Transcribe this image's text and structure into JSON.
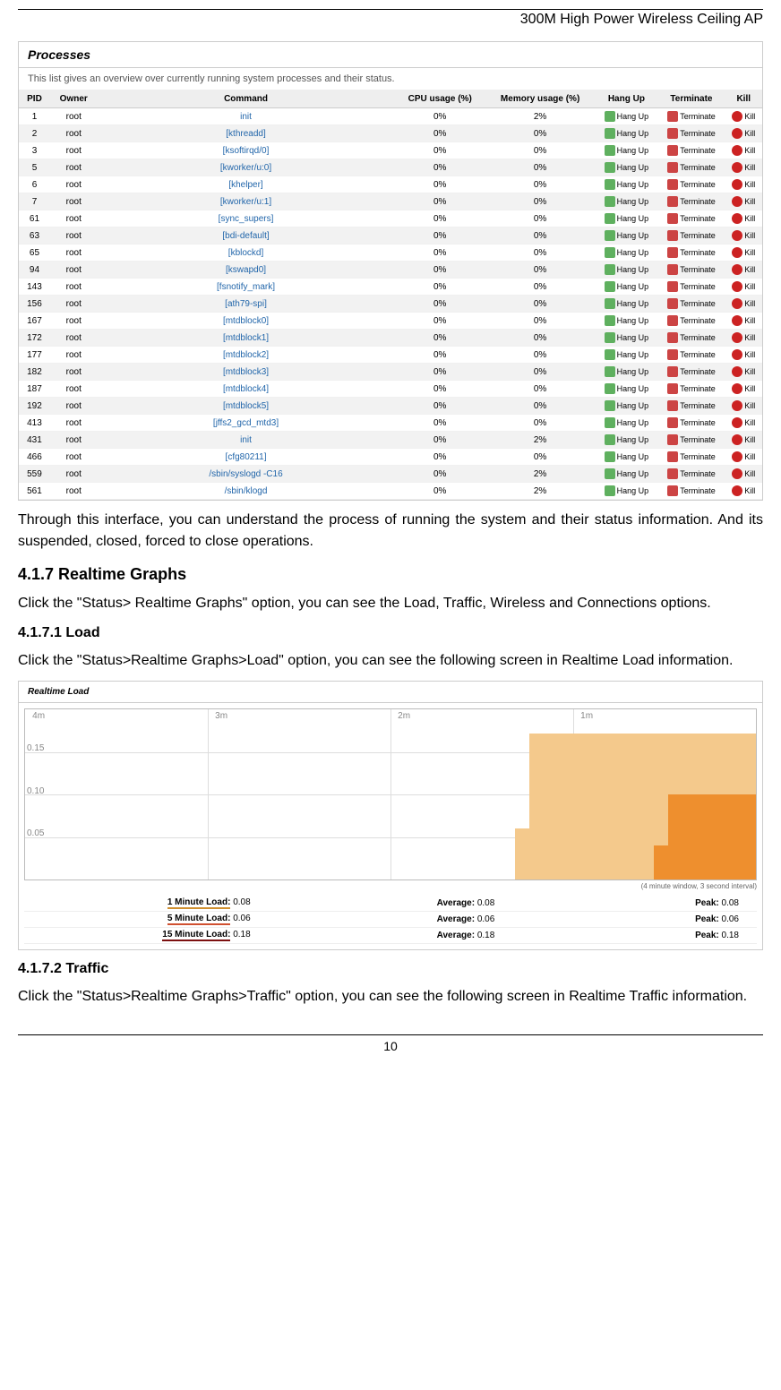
{
  "header": {
    "title": "300M High Power Wireless Ceiling AP"
  },
  "processes": {
    "title": "Processes",
    "subtitle": "This list gives an overview over currently running system processes and their status.",
    "columns": [
      "PID",
      "Owner",
      "Command",
      "CPU usage (%)",
      "Memory usage (%)",
      "Hang Up",
      "Terminate",
      "Kill"
    ],
    "hangup_label": "Hang Up",
    "terminate_label": "Terminate",
    "kill_label": "Kill",
    "rows": [
      {
        "pid": "1",
        "owner": "root",
        "cmd": "init",
        "cpu": "0%",
        "mem": "2%"
      },
      {
        "pid": "2",
        "owner": "root",
        "cmd": "[kthreadd]",
        "cpu": "0%",
        "mem": "0%"
      },
      {
        "pid": "3",
        "owner": "root",
        "cmd": "[ksoftirqd/0]",
        "cpu": "0%",
        "mem": "0%"
      },
      {
        "pid": "5",
        "owner": "root",
        "cmd": "[kworker/u:0]",
        "cpu": "0%",
        "mem": "0%"
      },
      {
        "pid": "6",
        "owner": "root",
        "cmd": "[khelper]",
        "cpu": "0%",
        "mem": "0%"
      },
      {
        "pid": "7",
        "owner": "root",
        "cmd": "[kworker/u:1]",
        "cpu": "0%",
        "mem": "0%"
      },
      {
        "pid": "61",
        "owner": "root",
        "cmd": "[sync_supers]",
        "cpu": "0%",
        "mem": "0%"
      },
      {
        "pid": "63",
        "owner": "root",
        "cmd": "[bdi-default]",
        "cpu": "0%",
        "mem": "0%"
      },
      {
        "pid": "65",
        "owner": "root",
        "cmd": "[kblockd]",
        "cpu": "0%",
        "mem": "0%"
      },
      {
        "pid": "94",
        "owner": "root",
        "cmd": "[kswapd0]",
        "cpu": "0%",
        "mem": "0%"
      },
      {
        "pid": "143",
        "owner": "root",
        "cmd": "[fsnotify_mark]",
        "cpu": "0%",
        "mem": "0%"
      },
      {
        "pid": "156",
        "owner": "root",
        "cmd": "[ath79-spi]",
        "cpu": "0%",
        "mem": "0%"
      },
      {
        "pid": "167",
        "owner": "root",
        "cmd": "[mtdblock0]",
        "cpu": "0%",
        "mem": "0%"
      },
      {
        "pid": "172",
        "owner": "root",
        "cmd": "[mtdblock1]",
        "cpu": "0%",
        "mem": "0%"
      },
      {
        "pid": "177",
        "owner": "root",
        "cmd": "[mtdblock2]",
        "cpu": "0%",
        "mem": "0%"
      },
      {
        "pid": "182",
        "owner": "root",
        "cmd": "[mtdblock3]",
        "cpu": "0%",
        "mem": "0%"
      },
      {
        "pid": "187",
        "owner": "root",
        "cmd": "[mtdblock4]",
        "cpu": "0%",
        "mem": "0%"
      },
      {
        "pid": "192",
        "owner": "root",
        "cmd": "[mtdblock5]",
        "cpu": "0%",
        "mem": "0%"
      },
      {
        "pid": "413",
        "owner": "root",
        "cmd": "[jffs2_gcd_mtd3]",
        "cpu": "0%",
        "mem": "0%"
      },
      {
        "pid": "431",
        "owner": "root",
        "cmd": "init",
        "cpu": "0%",
        "mem": "2%"
      },
      {
        "pid": "466",
        "owner": "root",
        "cmd": "[cfg80211]",
        "cpu": "0%",
        "mem": "0%"
      },
      {
        "pid": "559",
        "owner": "root",
        "cmd": "/sbin/syslogd -C16",
        "cpu": "0%",
        "mem": "2%"
      },
      {
        "pid": "561",
        "owner": "root",
        "cmd": "/sbin/klogd",
        "cpu": "0%",
        "mem": "2%"
      }
    ]
  },
  "para1": "Through this interface, you can understand the process of running the system and their status information. And its suspended, closed, forced to close operations.",
  "sec417": {
    "title": "4.1.7 Realtime Graphs",
    "text": "Click the \"Status> Realtime Graphs\" option, you can see the Load, Traffic, Wireless and Connections options."
  },
  "sec4171": {
    "title": "4.1.7.1 Load",
    "text": "Click the \"Status>Realtime Graphs>Load\" option, you can see the following screen in Realtime Load information."
  },
  "realtime": {
    "title": "Realtime Load",
    "xlabels": [
      "4m",
      "3m",
      "2m",
      "1m"
    ],
    "ylabels": [
      "0.15",
      "0.10",
      "0.05"
    ],
    "caption": "(4 minute window, 3 second interval)",
    "stats": {
      "r1": {
        "k": "1 Minute Load:",
        "v": "0.08",
        "avg_k": "Average:",
        "avg_v": "0.08",
        "peak_k": "Peak:",
        "peak_v": "0.08"
      },
      "r5": {
        "k": "5 Minute Load:",
        "v": "0.06",
        "avg_k": "Average:",
        "avg_v": "0.06",
        "peak_k": "Peak:",
        "peak_v": "0.06"
      },
      "r15": {
        "k": "15 Minute Load:",
        "v": "0.18",
        "avg_k": "Average:",
        "avg_v": "0.18",
        "peak_k": "Peak:",
        "peak_v": "0.18"
      }
    }
  },
  "sec4172": {
    "title": "4.1.7.2 Traffic",
    "text": "Click the \"Status>Realtime Graphs>Traffic\" option, you can see the following screen in Realtime Traffic information."
  },
  "page_number": "10"
}
